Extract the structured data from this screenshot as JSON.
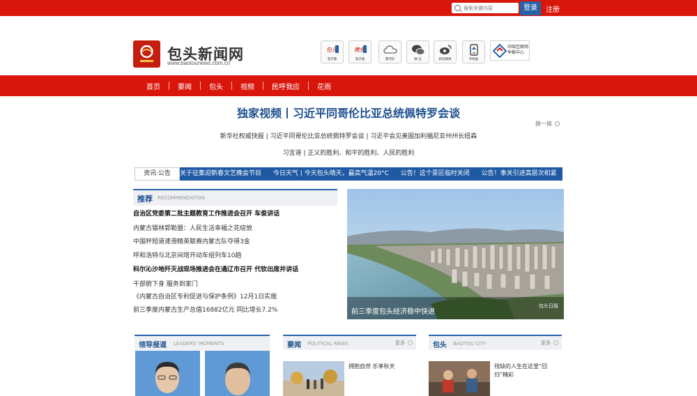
{
  "topbar": {
    "search_placeholder": "搜索关键内容",
    "login_label": "登录",
    "register_label": "注册"
  },
  "header": {
    "site_title": "包头新闻网",
    "site_url": "www.baotounews.com.cn",
    "icons": [
      {
        "icon": "baotou-daily-epaper-icon",
        "label": "电子版"
      },
      {
        "icon": "baotou-evening-epaper-icon",
        "label": "电子版"
      },
      {
        "icon": "cloud-icon",
        "label": "黄河云"
      },
      {
        "icon": "wechat-icon",
        "label": "微 信"
      },
      {
        "icon": "weibo-icon",
        "label": "新浪微博"
      },
      {
        "icon": "mobile-icon",
        "label": "手机报"
      }
    ],
    "report_center": {
      "line1": "中国互联网",
      "line2": "举报中心"
    }
  },
  "nav": {
    "items": [
      "首页",
      "要闻",
      "包头",
      "视频",
      "民呼我应",
      "花雨"
    ]
  },
  "headline": {
    "title": "独家视频丨习近平同哥伦比亚总统佩特罗会谈",
    "refresh_label": "换一换",
    "line1": "新华社权威快报 | 习近平同哥伦比亚总统佩特罗会谈 | 习近平会见美国加利福尼亚州州长纽森",
    "line2": "习言道 | 正义的胜利、和平的胜利、人民的胜利"
  },
  "ticker": {
    "label": "资讯·公告",
    "items": [
      "关于征集迎新春文艺晚会节目",
      "今日天气 | 今天包头晴天，最高气温20°C",
      "公告！这个景区临时关闭",
      "公告！事关引进高层次和紧"
    ]
  },
  "recommend": {
    "title": "推荐",
    "title_en": "RECOMMENDATION",
    "items": [
      {
        "text": "自治区党委第二批主题教育工作推进会召开 车俊讲话",
        "bold": true
      },
      {
        "text": "内蒙古锡林郭勒盟：人民生活幸福之花绽放",
        "bold": false
      },
      {
        "text": "中国杯短道速滑精英联赛内蒙古队夺得3金",
        "bold": false
      },
      {
        "text": "呼和浩特与北京间增开动车组列车10趟",
        "bold": false
      },
      {
        "text": "科尔沁沙地歼灭战现场推进会在通辽市召开 代钦出席并讲话",
        "bold": true
      },
      {
        "text": "干部俯下身 服务到家门",
        "bold": false
      },
      {
        "text": "《内蒙古自治区专利促进与保护条例》12月1日实施",
        "bold": false
      },
      {
        "text": "前三季度内蒙古生产总值16882亿元 同比增长7.2%",
        "bold": false
      }
    ]
  },
  "hero": {
    "caption": "前三季度包头经济稳中快进",
    "watermark": "包头日报"
  },
  "panels": {
    "leaders": {
      "title": "领导报道",
      "title_en": "LEADERS' MOMENTS"
    },
    "news": {
      "title": "要闻",
      "title_en": "POLITICAL NEWS",
      "more": "更多",
      "item_text": "拥抱自然 乐享秋天"
    },
    "baotou": {
      "title": "包头",
      "title_en": "BAOTOU CITY",
      "more": "更多",
      "item_text": "残缺的人生在这里“回归”精彩"
    }
  },
  "colors": {
    "brand_red": "#d9160b",
    "brand_blue": "#1e5aa4",
    "headline_blue": "#1d4f8e"
  }
}
